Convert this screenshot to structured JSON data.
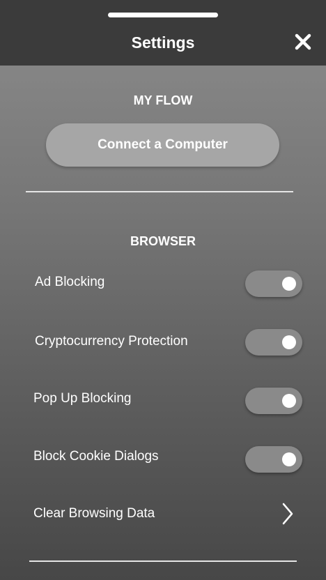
{
  "header": {
    "title": "Settings"
  },
  "my_flow": {
    "section_title": "MY FLOW",
    "connect_button_label": "Connect a Computer"
  },
  "browser": {
    "section_title": "BROWSER",
    "toggles": [
      {
        "label": "Ad Blocking",
        "enabled": true
      },
      {
        "label": "Cryptocurrency Protection",
        "enabled": true
      },
      {
        "label": "Pop Up Blocking",
        "enabled": true
      },
      {
        "label": "Block Cookie Dialogs",
        "enabled": true
      }
    ],
    "clear_data_label": "Clear Browsing Data"
  },
  "icons": {
    "close": "close-icon",
    "chevron": "chevron-right-icon"
  }
}
